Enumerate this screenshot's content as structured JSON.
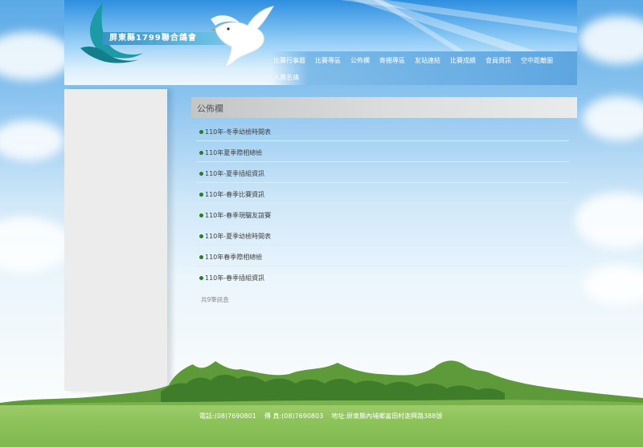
{
  "site": {
    "name": "屏東縣1799聯合鴿會"
  },
  "nav": {
    "items": [
      {
        "label": "比賽行事曆"
      },
      {
        "label": "比賽專區"
      },
      {
        "label": "公佈欄"
      },
      {
        "label": "寄棚專區"
      },
      {
        "label": "友站連結"
      },
      {
        "label": "比賽成績"
      },
      {
        "label": "會員資訊"
      },
      {
        "label": "空中距離圖"
      },
      {
        "label": "人賞名鴿"
      }
    ]
  },
  "main": {
    "section_title": "公佈欄",
    "announcements": [
      {
        "title": "110年-冬季幼檢時間表"
      },
      {
        "title": "110年夏季際相總檢"
      },
      {
        "title": "110年-夏季插組資訊"
      },
      {
        "title": "110年-春季比賽資訊"
      },
      {
        "title": "110年-春季現驪友誼賽"
      },
      {
        "title": "110年-夏季幼檢時間表"
      },
      {
        "title": "110年春季際相總檢"
      },
      {
        "title": "110年-春季插組資訊"
      }
    ],
    "count_text": "共9筆訊息"
  },
  "footer": {
    "text": "電話:(08)7690801    傳 真:(08)7690803    地址:屏東縣內埔鄉富田村迦興路388號"
  },
  "colors": {
    "accent": "#5ea6e0",
    "bullet": "#2a7a2a",
    "footer_green": "#8cc25a"
  }
}
